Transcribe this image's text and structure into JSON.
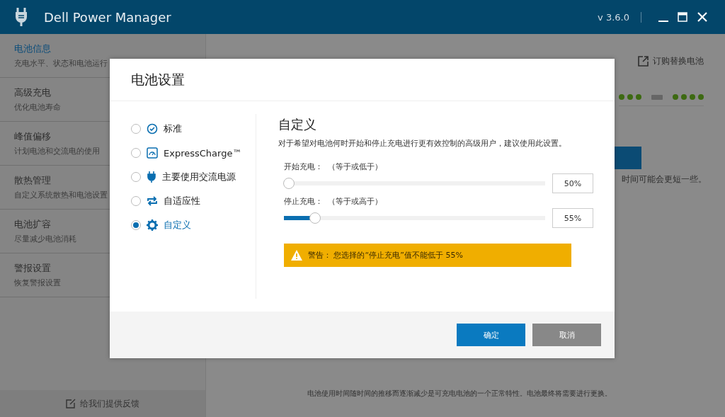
{
  "window": {
    "title": "Dell Power Manager",
    "version": "v 3.6.0"
  },
  "sidebar": {
    "items": [
      {
        "title": "电池信息",
        "subtitle": "充电水平、状态和电池运行",
        "selected": true
      },
      {
        "title": "高级充电",
        "subtitle": "优化电池寿命",
        "selected": false
      },
      {
        "title": "峰值偏移",
        "subtitle": "计划电池和交流电的使用",
        "selected": false
      },
      {
        "title": "散热管理",
        "subtitle": "自定义系统散热和电池设置",
        "selected": false
      },
      {
        "title": "电池扩容",
        "subtitle": "尽量减少电池消耗",
        "selected": false
      },
      {
        "title": "警报设置",
        "subtitle": "恢复警报设置",
        "selected": false
      }
    ],
    "feedback": "给我们提供反馈"
  },
  "main": {
    "order_link": "订购替换电池",
    "partial_note": "时间可能会更短一些。",
    "footer_note": "电池使用时间随时间的推移而逐渐减少是可充电电池的一个正常特性。电池最终将需要进行更换。"
  },
  "dialog": {
    "title": "电池设置",
    "modes": [
      {
        "label": "标准",
        "kind": "standard",
        "selected": false
      },
      {
        "label": "ExpressCharge™",
        "kind": "express",
        "selected": false
      },
      {
        "label": "主要使用交流电源",
        "kind": "ac",
        "selected": false
      },
      {
        "label": "自适应性",
        "kind": "adaptive",
        "selected": false
      },
      {
        "label": "自定义",
        "kind": "custom",
        "selected": true
      }
    ],
    "heading": "自定义",
    "description": "对于希望对电池何时开始和停止充电进行更有效控制的高级用户，建议使用此设置。",
    "sliders": [
      {
        "label": "开始充电：",
        "hint": "（等于或低于）",
        "level": 0.02,
        "value": "50%"
      },
      {
        "label": "停止充电：",
        "hint": "（等于或高于）",
        "level": 0.12,
        "value": "55%"
      }
    ],
    "warning": "警告： 您选择的“停止充电”值不能低于 55%",
    "buttons": [
      {
        "label": "确定",
        "kind": "primary"
      },
      {
        "label": "取消",
        "kind": "secondary"
      }
    ]
  }
}
